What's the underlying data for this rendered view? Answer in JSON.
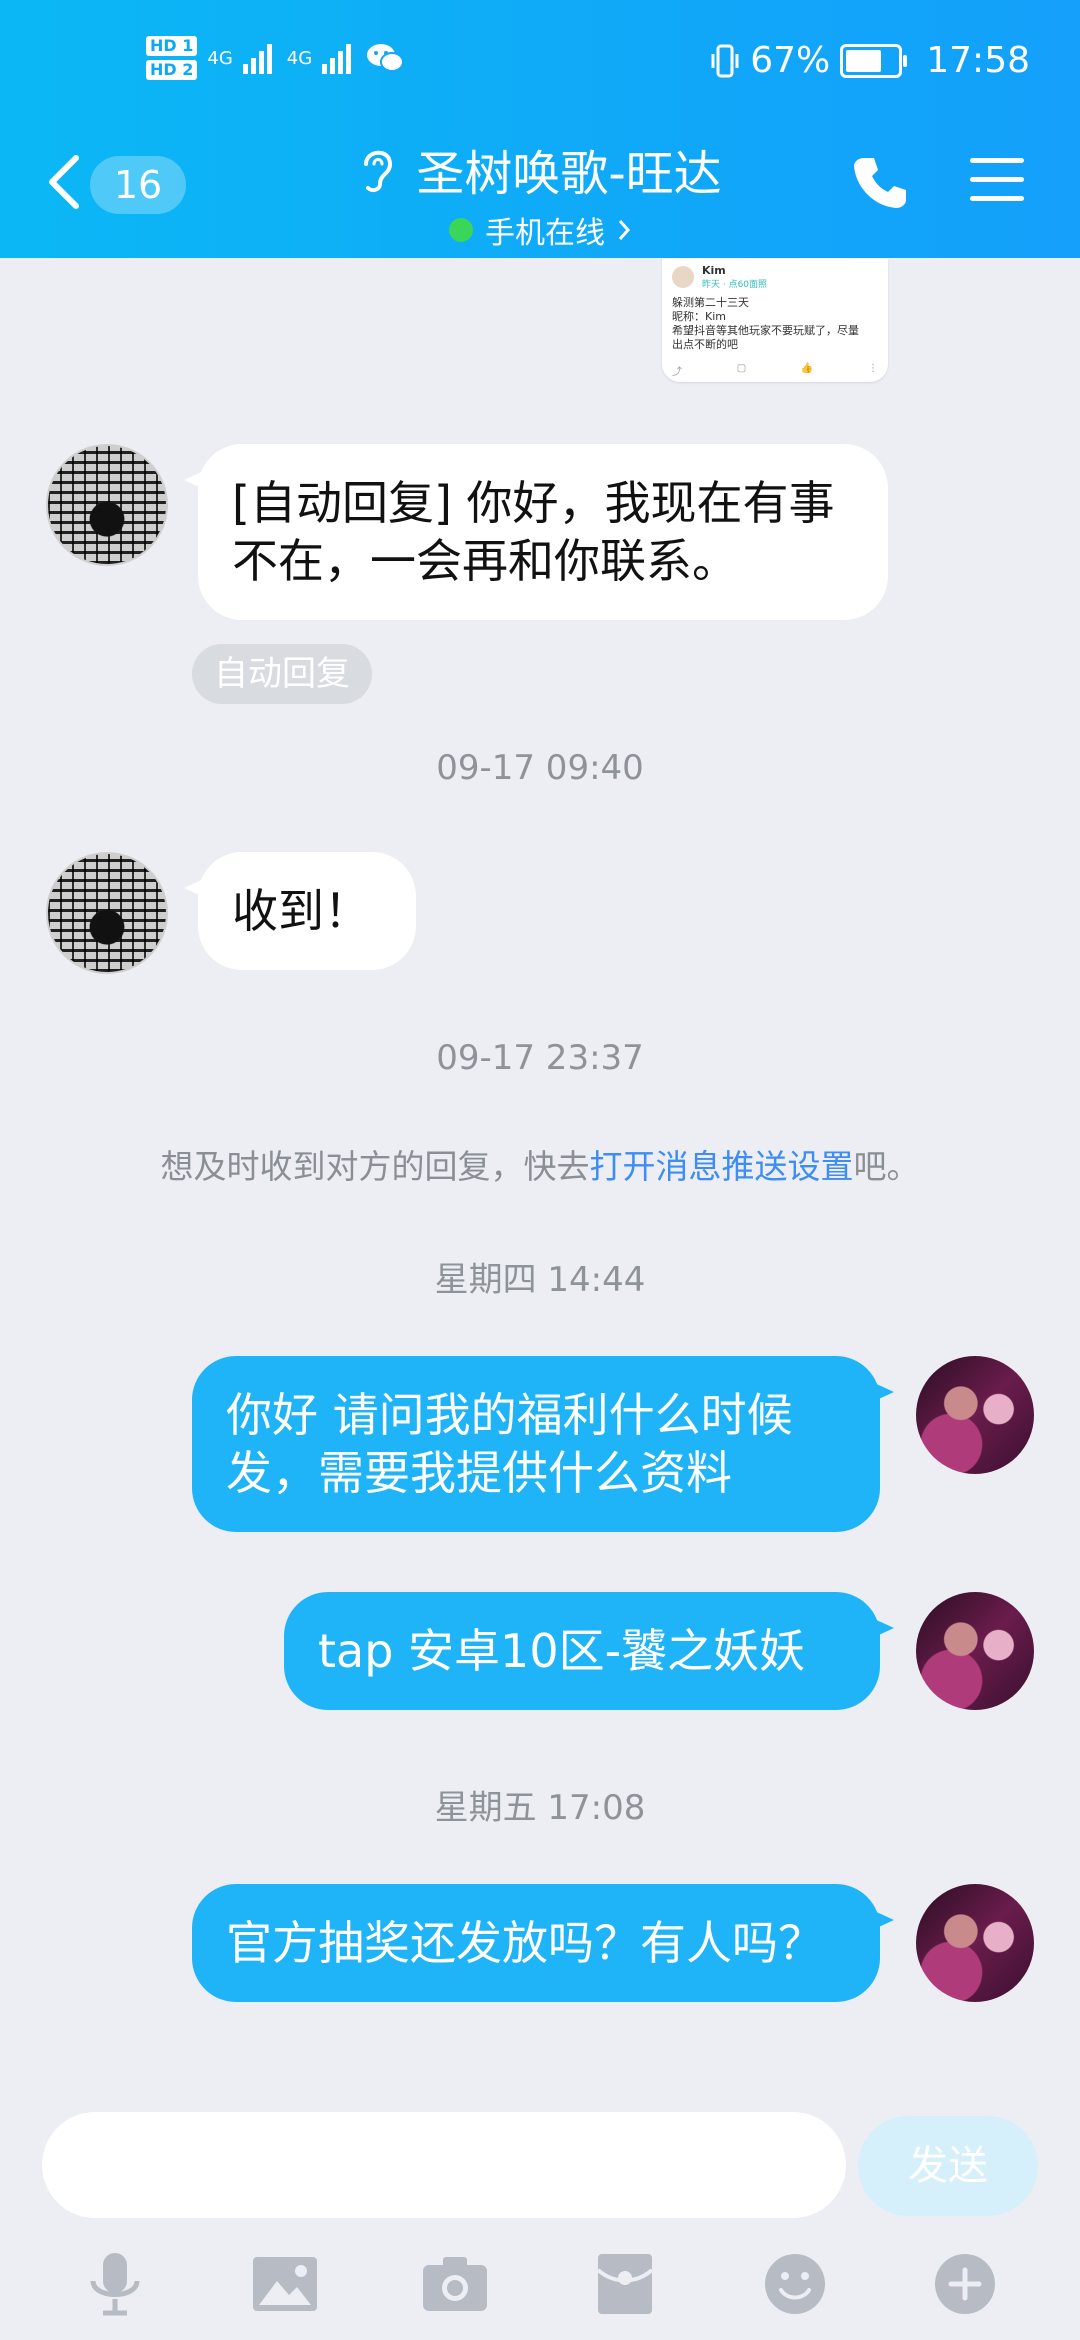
{
  "status_bar": {
    "hd1": "HD 1",
    "hd2": "HD 2",
    "net1": "4G",
    "net2": "4G",
    "battery_percent": "67%",
    "time": "17:58"
  },
  "header": {
    "unread_count": "16",
    "title": "圣树唤歌-旺达",
    "subtitle": "手机在线",
    "accent": "#10a8f8",
    "online_color": "#39d65a"
  },
  "preview_card": {
    "name": "Kim",
    "time": "昨天 · 点60面照",
    "line1": "躲测第二十三天",
    "line2": "昵称：Kim",
    "line3": "希望抖音等其他玩家不要玩赋了，尽量",
    "line4": "出点不断的吧"
  },
  "messages": [
    {
      "side": "in",
      "text": "[自动回复] 你好，我现在有事不在，一会再和你联系。"
    },
    {
      "side": "in",
      "text": "收到！"
    },
    {
      "side": "out",
      "text": "你好 请问我的福利什么时候发，需要我提供什么资料"
    },
    {
      "side": "out",
      "text": "tap 安卓10区-饕之妖妖"
    },
    {
      "side": "out",
      "text": "官方抽奖还发放吗？有人吗？"
    }
  ],
  "auto_reply_tag": "自动回复",
  "timestamps": [
    "09-17 09:40",
    "09-17 23:37",
    "星期四 14:44",
    "星期五 17:08"
  ],
  "notice": {
    "prefix": "想及时收到对方的回复，快去",
    "link": "打开消息推送设置",
    "suffix": "吧。"
  },
  "input": {
    "placeholder": "",
    "send_label": "发送"
  },
  "toolbar": {
    "icons": [
      "microphone-icon",
      "image-icon",
      "camera-icon",
      "red-packet-icon",
      "emoji-icon",
      "plus-icon"
    ]
  }
}
